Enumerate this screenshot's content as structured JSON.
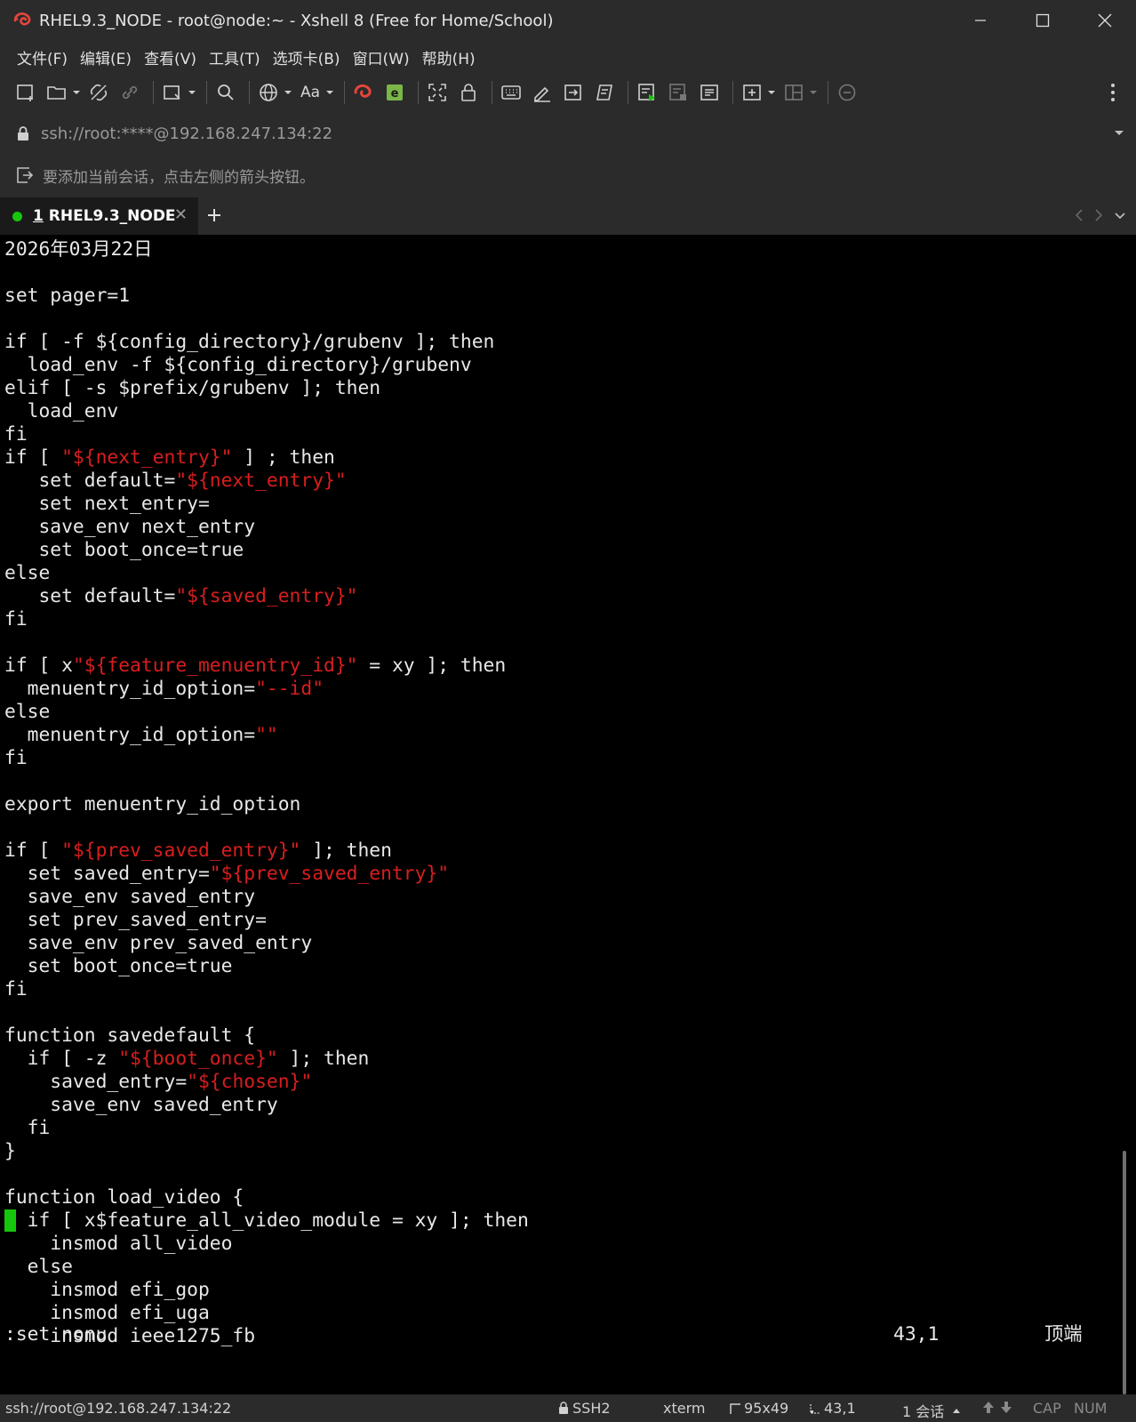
{
  "window": {
    "title": "RHEL9.3_NODE - root@node:~ - Xshell 8 (Free for Home/School)"
  },
  "menu": [
    "文件(F)",
    "编辑(E)",
    "查看(V)",
    "工具(T)",
    "选项卡(B)",
    "窗口(W)",
    "帮助(H)"
  ],
  "toolbar": {
    "font_label": "Aa"
  },
  "address": {
    "value": "ssh://root:****@192.168.247.134:22"
  },
  "hint": {
    "text": "要添加当前会话，点击左侧的箭头按钮。"
  },
  "tabs": [
    {
      "number": "1",
      "label": "RHEL9.3_NODE",
      "active": true,
      "status_color": "#16c60c"
    }
  ],
  "terminal": {
    "lines": [
      [
        {
          "t": "2026年03月22日"
        }
      ],
      [
        {
          "t": ""
        }
      ],
      [
        {
          "t": "set pager=1"
        }
      ],
      [
        {
          "t": ""
        }
      ],
      [
        {
          "t": "if [ -f ${config_directory}/grubenv ]; then"
        }
      ],
      [
        {
          "t": "  load_env -f ${config_directory}/grubenv"
        }
      ],
      [
        {
          "t": "elif [ -s $prefix/grubenv ]; then"
        }
      ],
      [
        {
          "t": "  load_env"
        }
      ],
      [
        {
          "t": "fi"
        }
      ],
      [
        {
          "t": "if [ "
        },
        {
          "t": "\"${next_entry}\"",
          "s": 1
        },
        {
          "t": " ] ; then"
        }
      ],
      [
        {
          "t": "   set default="
        },
        {
          "t": "\"${next_entry}\"",
          "s": 1
        }
      ],
      [
        {
          "t": "   set next_entry="
        }
      ],
      [
        {
          "t": "   save_env next_entry"
        }
      ],
      [
        {
          "t": "   set boot_once=true"
        }
      ],
      [
        {
          "t": "else"
        }
      ],
      [
        {
          "t": "   set default="
        },
        {
          "t": "\"${saved_entry}\"",
          "s": 1
        }
      ],
      [
        {
          "t": "fi"
        }
      ],
      [
        {
          "t": ""
        }
      ],
      [
        {
          "t": "if [ x"
        },
        {
          "t": "\"${feature_menuentry_id}\"",
          "s": 1
        },
        {
          "t": " = xy ]; then"
        }
      ],
      [
        {
          "t": "  menuentry_id_option="
        },
        {
          "t": "\"--id\"",
          "s": 1
        }
      ],
      [
        {
          "t": "else"
        }
      ],
      [
        {
          "t": "  menuentry_id_option="
        },
        {
          "t": "\"\"",
          "s": 1
        }
      ],
      [
        {
          "t": "fi"
        }
      ],
      [
        {
          "t": ""
        }
      ],
      [
        {
          "t": "export menuentry_id_option"
        }
      ],
      [
        {
          "t": ""
        }
      ],
      [
        {
          "t": "if [ "
        },
        {
          "t": "\"${prev_saved_entry}\"",
          "s": 1
        },
        {
          "t": " ]; then"
        }
      ],
      [
        {
          "t": "  set saved_entry="
        },
        {
          "t": "\"${prev_saved_entry}\"",
          "s": 1
        }
      ],
      [
        {
          "t": "  save_env saved_entry"
        }
      ],
      [
        {
          "t": "  set prev_saved_entry="
        }
      ],
      [
        {
          "t": "  save_env prev_saved_entry"
        }
      ],
      [
        {
          "t": "  set boot_once=true"
        }
      ],
      [
        {
          "t": "fi"
        }
      ],
      [
        {
          "t": ""
        }
      ],
      [
        {
          "t": "function savedefault {"
        }
      ],
      [
        {
          "t": "  if [ -z "
        },
        {
          "t": "\"${boot_once}\"",
          "s": 1
        },
        {
          "t": " ]; then"
        }
      ],
      [
        {
          "t": "    saved_entry="
        },
        {
          "t": "\"${chosen}\"",
          "s": 1
        }
      ],
      [
        {
          "t": "    save_env saved_entry"
        }
      ],
      [
        {
          "t": "  fi"
        }
      ],
      [
        {
          "t": "}"
        }
      ],
      [
        {
          "t": ""
        }
      ],
      [
        {
          "t": "function load_video {"
        }
      ],
      [
        {
          "t": " ",
          "c": 1
        },
        {
          "t": " if [ x$feature_all_video_module = xy ]; then"
        }
      ],
      [
        {
          "t": "    insmod all_video"
        }
      ],
      [
        {
          "t": "  else"
        }
      ],
      [
        {
          "t": "    insmod efi_gop"
        }
      ],
      [
        {
          "t": "    insmod efi_uga"
        }
      ],
      [
        {
          "t": "    insmod ieee1275_fb"
        }
      ]
    ],
    "vim_command": ":set nonu",
    "vim_position": "43,1",
    "vim_scroll": "顶端",
    "colors": {
      "string": "#d81e1e",
      "cursor": "#16c60c"
    }
  },
  "statusbar": {
    "connection": "ssh://root@192.168.247.134:22",
    "protocol": "SSH2",
    "terminal_type": "xterm",
    "size": "95x49",
    "cursor_pos": "43,1",
    "sessions": "1 会话",
    "cap": "CAP",
    "num": "NUM"
  }
}
